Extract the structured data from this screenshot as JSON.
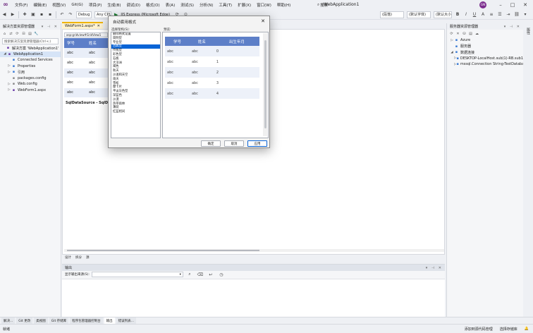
{
  "app": {
    "title": "WebApplication1",
    "user_initials": "GN",
    "copilot": "GitHub Copilot",
    "search": "搜索"
  },
  "menu": [
    "文件(F)",
    "编辑(E)",
    "视图(V)",
    "Git(G)",
    "项目(P)",
    "生成(B)",
    "调试(D)",
    "格式(O)",
    "表(A)",
    "测试(S)",
    "分析(N)",
    "工具(T)",
    "扩展(X)",
    "窗口(W)",
    "帮助(H)"
  ],
  "toolbar": {
    "config": "Debug",
    "platform": "Any CPU",
    "run_target": "IIS Express (Microsoft Edge)",
    "block_format": "(段落)",
    "font_name": "(默认字体)",
    "font_size": "(默认大小)"
  },
  "solution_explorer": {
    "title": "解决方案资源管理器",
    "search_placeholder": "搜索解决方案资源管理器(Ctrl+;)",
    "items": [
      {
        "label": "解决方案 'WebApplication1'",
        "arrow": "",
        "icon": "solution-icon"
      },
      {
        "label": "WebApplication1",
        "arrow": "◢",
        "icon": "web-project-icon"
      },
      {
        "label": "Connected Services",
        "arrow": "",
        "icon": "connected-services-icon"
      },
      {
        "label": "Properties",
        "arrow": "▷",
        "icon": "wrench-icon"
      },
      {
        "label": "引用",
        "arrow": "▷",
        "icon": "references-icon"
      },
      {
        "label": "packages.config",
        "arrow": "",
        "icon": "config-file-icon"
      },
      {
        "label": "Web.config",
        "arrow": "▷",
        "icon": "config-file-icon"
      },
      {
        "label": "WebForm1.aspx",
        "arrow": "▷",
        "icon": "aspx-file-icon"
      }
    ]
  },
  "editor": {
    "tabs": [
      {
        "label": "WebForm1.aspx*",
        "active": true
      }
    ],
    "design_strip": "asp:gridview#GridView1",
    "gridview": {
      "headers": [
        "学号",
        "姓名"
      ],
      "rows": [
        [
          "abc",
          "abc"
        ],
        [
          "abc",
          "abc"
        ],
        [
          "abc",
          "abc"
        ],
        [
          "abc",
          "abc"
        ],
        [
          "abc",
          "abc"
        ]
      ]
    },
    "datasource_label": "SqlDataSource - SqlDataSource1",
    "bottom_tabs": [
      "设计",
      "拆分",
      "源"
    ]
  },
  "output": {
    "title": "输出",
    "show_from_label": "显示输出来源(S):",
    "source_value": ""
  },
  "server_explorer": {
    "title": "服务器资源管理器",
    "items": [
      {
        "label": "Azure",
        "arrow": "▷",
        "icon": "azure-icon"
      },
      {
        "label": "服务器",
        "arrow": "",
        "icon": "servers-icon"
      },
      {
        "label": "数据连接",
        "arrow": "◢",
        "icon": "data-connections-icon"
      },
      {
        "label": "DESKTOP-LocalHost.sub(1)-RB.sub1",
        "arrow": "▷",
        "icon": "db-connection-icon"
      },
      {
        "label": "mssql.Connection String-TestDatabase",
        "arrow": "▷",
        "icon": "db-connection-icon"
      }
    ]
  },
  "right_strip": {
    "label": "属性"
  },
  "bottom_tabs": [
    "解决...",
    "Git 更改",
    "类视图",
    "Git 存储库",
    "程序包管理器控制台",
    "输出",
    "错误列表..."
  ],
  "status": {
    "left": "就绪",
    "source_control": "添加到源代码管理",
    "repo": "选择存储库"
  },
  "dialog": {
    "title": "自动套用格式",
    "scheme_label": "选择架构(S):",
    "preview_label": "预览:",
    "schemes": [
      "删除格式设置",
      "简明型",
      "专业型",
      "古典型",
      "传统型",
      "彩色型",
      "石板",
      "大洋洲",
      "褐色",
      "秋天",
      "沙滩和天空",
      "雨天",
      "雪松",
      "摩卡片",
      "平淡灰色型",
      "深蓝色",
      "沙漠",
      "热带雨林",
      "薄荷",
      "红蓝相间"
    ],
    "selected_scheme": 3,
    "preview": {
      "headers": [
        "学号",
        "姓名",
        "出生年月"
      ],
      "rows": [
        [
          "abc",
          "abc",
          "0"
        ],
        [
          "abc",
          "abc",
          "1"
        ],
        [
          "abc",
          "abc",
          "2"
        ],
        [
          "abc",
          "abc",
          "3"
        ],
        [
          "abc",
          "abc",
          "4"
        ]
      ]
    },
    "buttons": {
      "ok": "确定",
      "cancel": "取消",
      "apply": "应用"
    }
  }
}
